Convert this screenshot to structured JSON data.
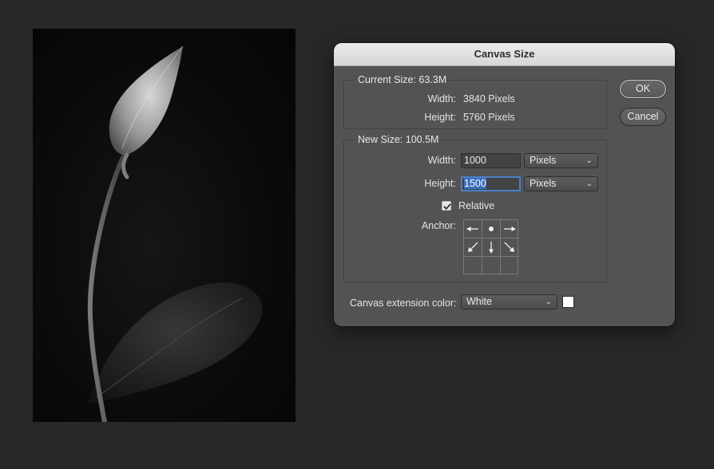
{
  "dialog": {
    "title": "Canvas Size",
    "ok_label": "OK",
    "cancel_label": "Cancel"
  },
  "current_size": {
    "title": "Current Size: 63.3M",
    "width_label": "Width:",
    "width_value": "3840 Pixels",
    "height_label": "Height:",
    "height_value": "5760 Pixels"
  },
  "new_size": {
    "title": "New Size: 100.5M",
    "width_label": "Width:",
    "width_value": "1000",
    "width_unit": "Pixels",
    "height_label": "Height:",
    "height_value": "1500",
    "height_unit": "Pixels",
    "relative_label": "Relative",
    "relative_checked": true,
    "anchor_label": "Anchor:"
  },
  "extension": {
    "label": "Canvas extension color:",
    "value": "White",
    "swatch_color": "#ffffff"
  },
  "colors": {
    "app_background": "#282828",
    "dialog_background": "#535353",
    "focus_accent": "#4a80c8"
  }
}
